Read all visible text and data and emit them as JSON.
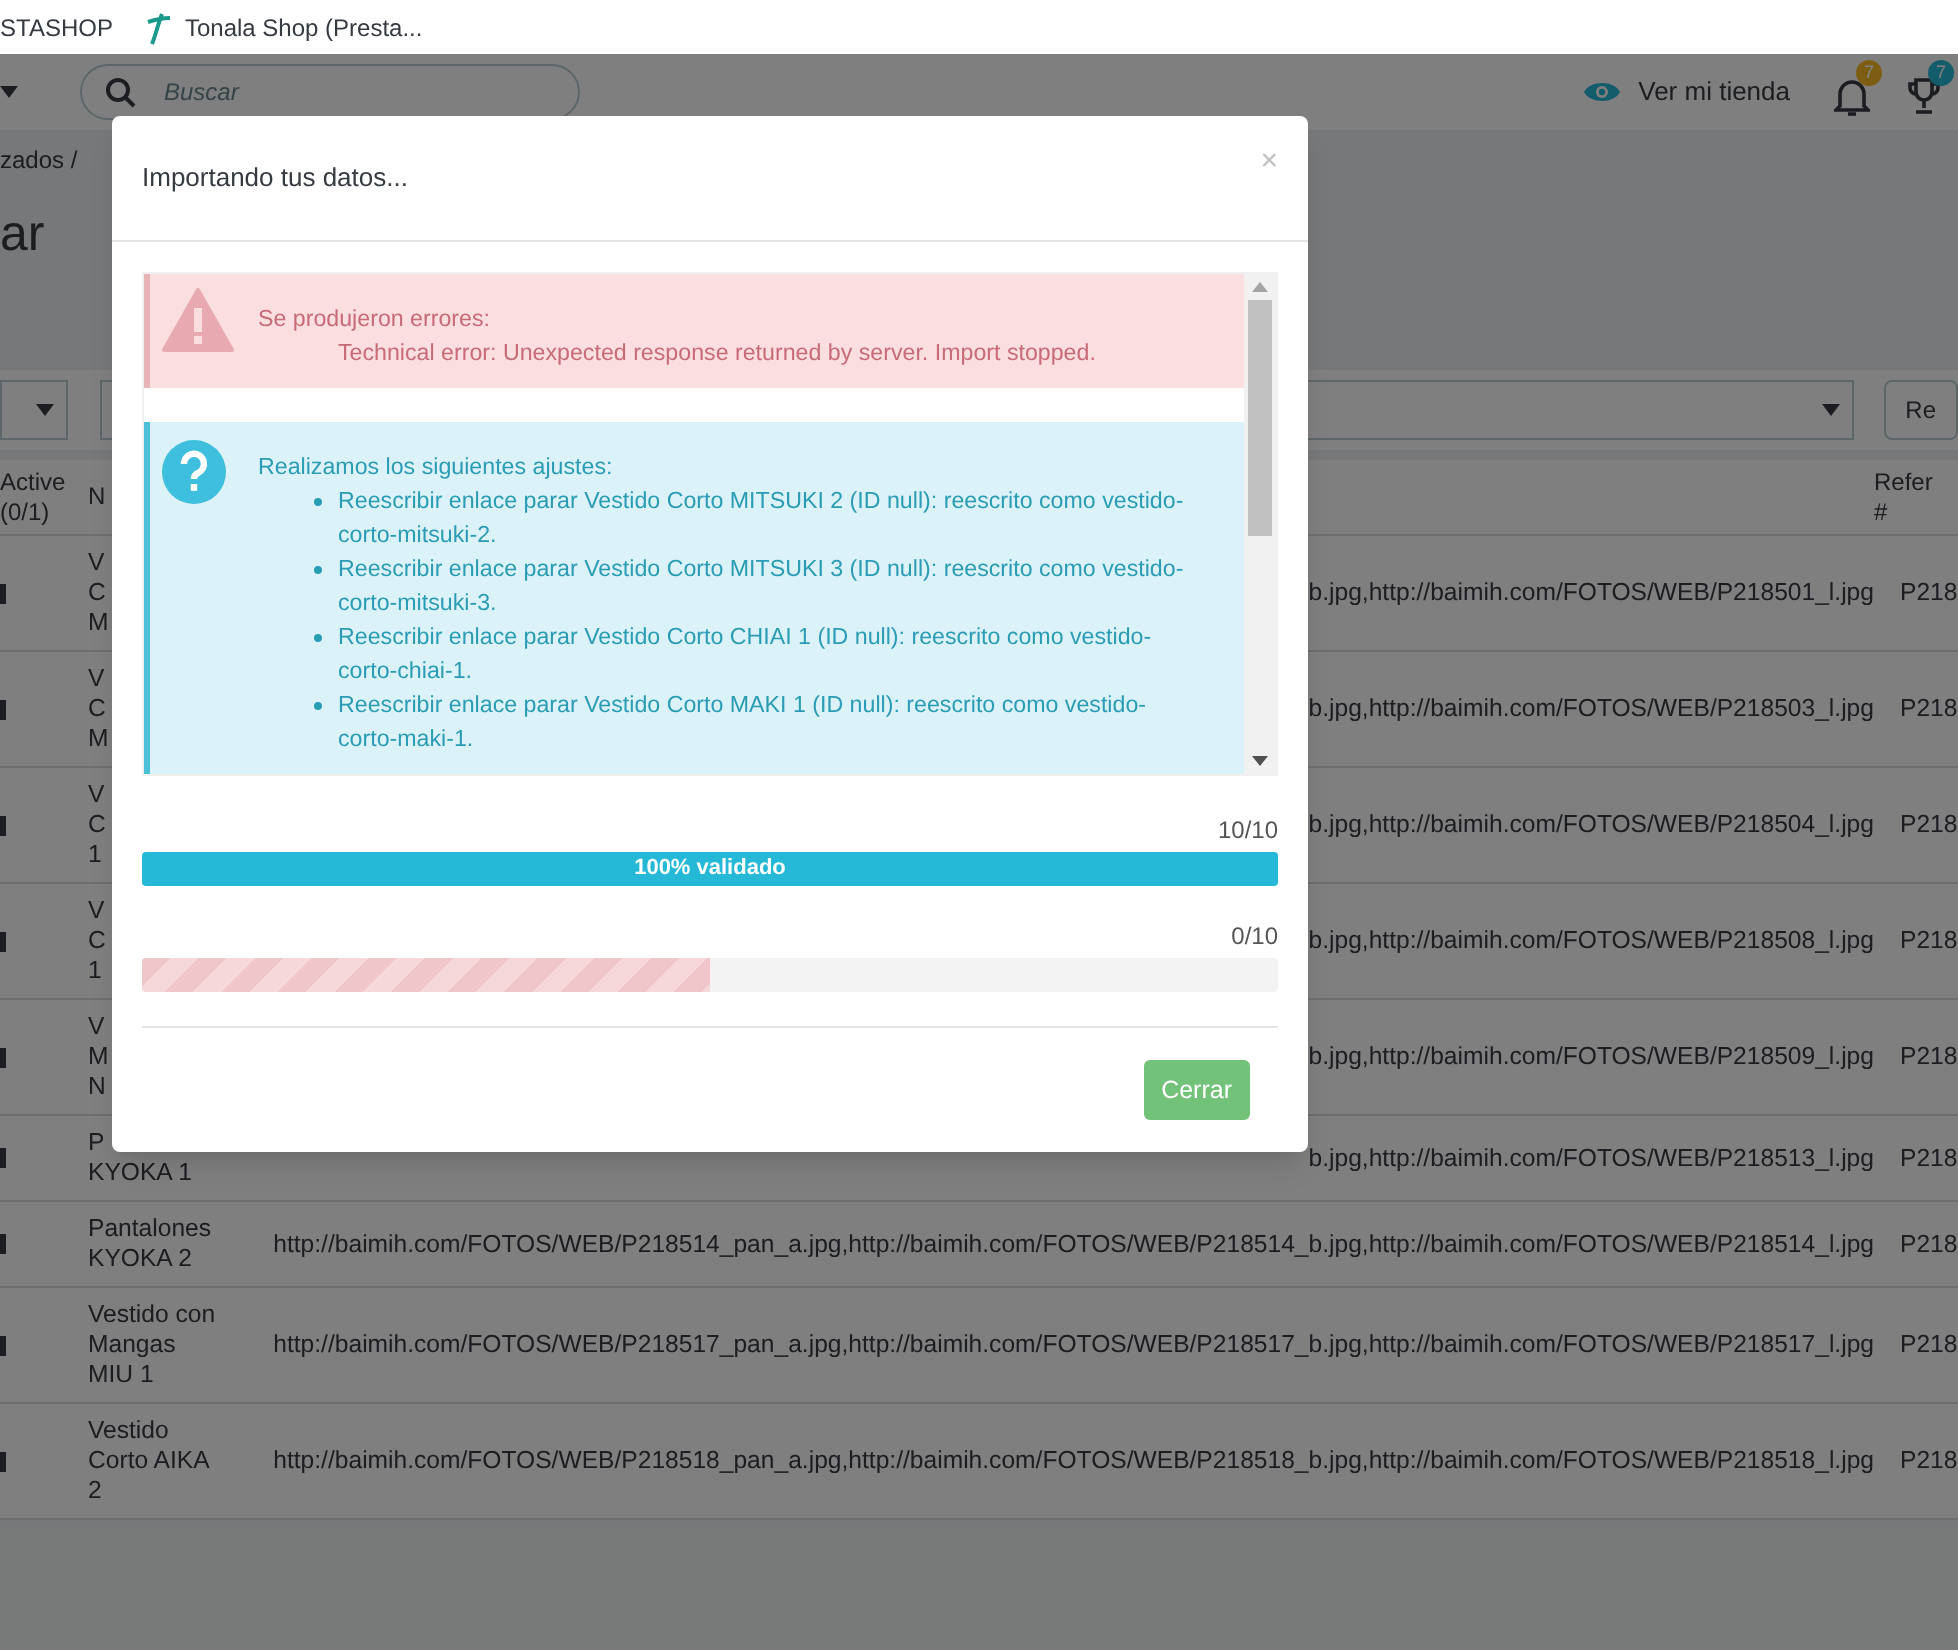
{
  "bookmarks": [
    {
      "kind": "plain",
      "label": "STASHOP"
    },
    {
      "kind": "tonala",
      "label": "Tonala Shop (Presta..."
    }
  ],
  "header": {
    "search": {
      "placeholder": "Buscar"
    },
    "view_store": "Ver mi tienda",
    "notifications": [
      {
        "kind": "bell",
        "count": "7"
      },
      {
        "kind": "trophy",
        "count": "7"
      }
    ]
  },
  "breadcrumb": "zados /",
  "page_title": "ar",
  "filter_button": "Re",
  "table": {
    "columns": [
      [
        "Active",
        "(0/1)"
      ],
      [
        "N"
      ],
      [
        "Refer",
        "#"
      ]
    ],
    "rows": [
      {
        "name_lines": [
          "V",
          "C",
          "M"
        ],
        "images": "b.jpg,http://baimih.com/FOTOS/WEB/P218501_l.jpg",
        "reference": "P218"
      },
      {
        "name_lines": [
          "V",
          "C",
          "M"
        ],
        "images": "b.jpg,http://baimih.com/FOTOS/WEB/P218503_l.jpg",
        "reference": "P218"
      },
      {
        "name_lines": [
          "V",
          "C",
          "1"
        ],
        "images": "b.jpg,http://baimih.com/FOTOS/WEB/P218504_l.jpg",
        "reference": "P218"
      },
      {
        "name_lines": [
          "V",
          "C",
          "1"
        ],
        "images": "b.jpg,http://baimih.com/FOTOS/WEB/P218508_l.jpg",
        "reference": "P218"
      },
      {
        "name_lines": [
          "V",
          "M",
          "N"
        ],
        "images": "b.jpg,http://baimih.com/FOTOS/WEB/P218509_l.jpg",
        "reference": "P218"
      },
      {
        "name_lines": [
          "P",
          "KYOKA 1"
        ],
        "images": "b.jpg,http://baimih.com/FOTOS/WEB/P218513_l.jpg",
        "reference": "P218"
      },
      {
        "name_lines": [
          "Pantalones",
          "KYOKA 2"
        ],
        "images": "http://baimih.com/FOTOS/WEB/P218514_pan_a.jpg,http://baimih.com/FOTOS/WEB/P218514_b.jpg,http://baimih.com/FOTOS/WEB/P218514_l.jpg",
        "reference": "P218"
      },
      {
        "name_lines": [
          "Vestido con",
          "Mangas",
          "MIU 1"
        ],
        "images": "http://baimih.com/FOTOS/WEB/P218517_pan_a.jpg,http://baimih.com/FOTOS/WEB/P218517_b.jpg,http://baimih.com/FOTOS/WEB/P218517_l.jpg",
        "reference": "P218"
      },
      {
        "name_lines": [
          "Vestido",
          "Corto AIKA",
          "2"
        ],
        "images": "http://baimih.com/FOTOS/WEB/P218518_pan_a.jpg,http://baimih.com/FOTOS/WEB/P218518_b.jpg,http://baimih.com/FOTOS/WEB/P218518_l.jpg",
        "reference": "P218"
      }
    ]
  },
  "modal": {
    "title": "Importando tus datos...",
    "close": "×",
    "alerts": [
      {
        "kind": "error",
        "heading": "Se produjeron errores:",
        "items": [
          "Technical error: Unexpected response returned by server. Import stopped."
        ]
      },
      {
        "kind": "info",
        "heading": "Realizamos los siguientes ajustes:",
        "items": [
          "Reescribir enlace parar Vestido Corto MITSUKI 2 (ID null): reescrito como vestido-corto-mitsuki-2.",
          "Reescribir enlace parar Vestido Corto MITSUKI 3 (ID null): reescrito como vestido-corto-mitsuki-3.",
          "Reescribir enlace parar Vestido Corto CHIAI 1 (ID null): reescrito como vestido-corto-chiai-1.",
          "Reescribir enlace parar Vestido Corto MAKI 1 (ID null): reescrito como vestido-corto-maki-1."
        ]
      }
    ],
    "progress": [
      {
        "kind": "validation",
        "count": "10/10",
        "level": 1,
        "label": "100% validado"
      },
      {
        "kind": "import",
        "count": "0/10",
        "level": 0.5
      }
    ],
    "button": "Cerrar"
  }
}
